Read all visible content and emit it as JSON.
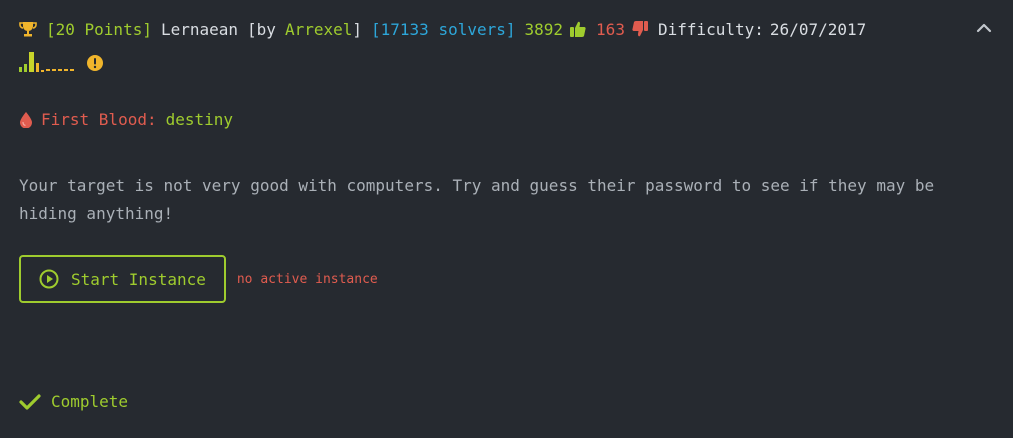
{
  "header": {
    "points": "[20 Points]",
    "title": "Lernaean",
    "by_prefix": "[by",
    "author": "Arrexel",
    "by_suffix": "]",
    "solvers": "[17133 solvers]",
    "likes": "3892",
    "dislikes": "163",
    "difficulty_label": "Difficulty:",
    "date": "26/07/2017"
  },
  "difficulty_bars": [
    {
      "level": 0.25,
      "color": "#9fcc2e"
    },
    {
      "level": 0.4,
      "color": "#9fcc2e"
    },
    {
      "level": 1.0,
      "color": "#c8d42a"
    },
    {
      "level": 0.45,
      "color": "#f0b52c"
    },
    {
      "level": 0.1,
      "color": "#f0b52c"
    }
  ],
  "first_blood": {
    "label": "First Blood:",
    "user": "destiny"
  },
  "description": "Your target is not very good with computers. Try and guess their password to see if they may be hiding anything!",
  "instance": {
    "button_label": "Start Instance",
    "status": "no active instance"
  },
  "footer": {
    "complete_label": "Complete"
  },
  "colors": {
    "background": "#262a30",
    "accent_green": "#9fcc2e",
    "info_blue": "#2da6d9",
    "danger_red": "#e05c4f",
    "warn_yellow": "#f0b52c"
  },
  "icons": {
    "trophy": "trophy-icon",
    "thumbs_up": "thumbs-up-icon",
    "thumbs_down": "thumbs-down-icon",
    "chevron": "chevron-up-icon",
    "warning": "exclamation-circle-icon",
    "blood": "blood-drop-icon",
    "play": "play-circle-icon",
    "check": "check-icon"
  }
}
